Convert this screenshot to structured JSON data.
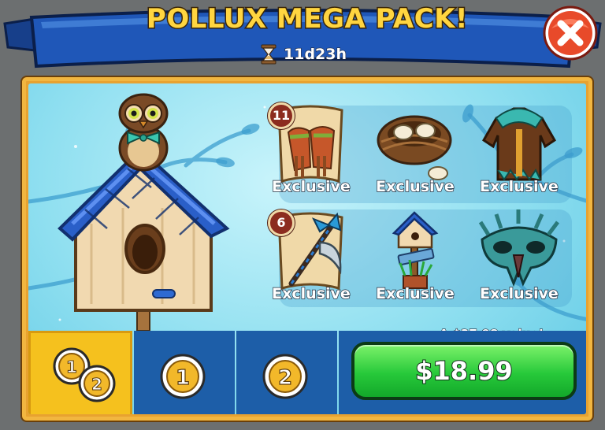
{
  "header": {
    "title": "POLLUX MEGA PACK!",
    "timer_icon": "hourglass-icon",
    "timer": "11d23h",
    "close_icon": "close-icon"
  },
  "items": [
    {
      "name": "gauntlets",
      "label": "Exclusive",
      "count": "11"
    },
    {
      "name": "nest-with-eggs",
      "label": "Exclusive"
    },
    {
      "name": "feathered-coat",
      "label": "Exclusive"
    },
    {
      "name": "battle-axe",
      "label": "Exclusive",
      "count": "6"
    },
    {
      "name": "birdhouse-decoration",
      "label": "Exclusive"
    },
    {
      "name": "feather-mask",
      "label": "Exclusive"
    }
  ],
  "offer": {
    "value_text": "A $37.98 value!",
    "price": "$18.99"
  },
  "tabs": [
    {
      "label_a": "1",
      "label_b": "2",
      "selected": true
    },
    {
      "label": "1",
      "selected": false
    },
    {
      "label": "2",
      "selected": false
    }
  ],
  "colors": {
    "ribbon": "#1f57b8",
    "panel_border": "#f2b640",
    "tab_selected": "#f5c11e",
    "tab": "#1d5ea8",
    "buy_button": "#27c93a",
    "title": "#ffd540"
  }
}
